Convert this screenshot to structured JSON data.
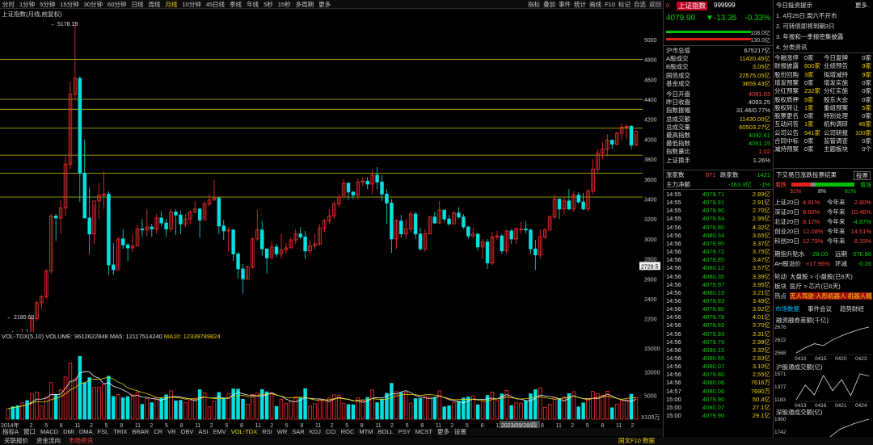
{
  "toolbar": {
    "periods": [
      "分时",
      "1分钟",
      "5分钟",
      "15分钟",
      "30分钟",
      "60分钟",
      "日线",
      "周线",
      "月线",
      "10分钟",
      "45日线",
      "季线",
      "年线",
      "5秒",
      "15秒",
      "多周期",
      "更多"
    ],
    "selected_period": "月线",
    "tools": [
      "指标",
      "叠加",
      "事件",
      "统计",
      "画线",
      "F10",
      "标记",
      "自选",
      "返回"
    ]
  },
  "chart_title": "上证指数(月线,前复权)",
  "price_axis": {
    "labels": [
      "5000",
      "4800",
      "4600",
      "4400",
      "4200",
      "4000",
      "3800",
      "3600",
      "3400",
      "3200",
      "3000",
      "2800",
      "2600",
      "2400",
      "2200"
    ],
    "current": "2729.5",
    "high_label": "5178.19",
    "low_label": "2180.60",
    "left_ticks": [
      "4500",
      "3000",
      "2500"
    ]
  },
  "volume_legend": {
    "name": "VOL-TDX(5,10)",
    "volume": "VOLUME: 9612622848",
    "ma5": "MA5: 12117514240",
    "ma10": "MA10: 12339789824"
  },
  "volume_axis": {
    "labels": [
      "15000",
      "10000",
      "5000"
    ],
    "unit": "X100万"
  },
  "xaxis": {
    "labels": [
      "2014年",
      "2",
      "5",
      "8",
      "11",
      "2",
      "5",
      "8",
      "11",
      "2",
      "5",
      "8",
      "11",
      "2",
      "5",
      "8",
      "11",
      "2",
      "5",
      "8",
      "11",
      "2",
      "5",
      "8",
      "11",
      "2",
      "5",
      "8",
      "11",
      "2",
      "5",
      "8",
      "11",
      "2",
      "5",
      "8",
      "11",
      "2",
      "5",
      "8",
      "11",
      "2"
    ],
    "cursor_date": "2023/09/28/四"
  },
  "indicator_tabs": [
    "指标A",
    "窗口",
    "MACD",
    "DMI",
    "DMA",
    "FSL",
    "TRIX",
    "BRAR",
    "CR",
    "VR",
    "OBV",
    "ASI",
    "EMV",
    "VOL-TDX",
    "RSI",
    "WR",
    "SAR",
    "KDJ",
    "CCI",
    "ROC",
    "MTM",
    "BOLL",
    "PSY",
    "MCST",
    "更多",
    "设置"
  ],
  "selected_indicator": "VOL-TDX",
  "bottom_bar": [
    "关联报价",
    "资金流向",
    "市场资讯"
  ],
  "bottom_right": "国文F10 数据",
  "side": {
    "header": {
      "flag": "0",
      "name": "上证指数",
      "code": "999999"
    },
    "price": "4079.90",
    "change": "▼-13.35",
    "pct": "-0.33%",
    "bars": {
      "up": "108.0亿",
      "down": "130.0亿"
    },
    "stats": [
      {
        "label": "沪市总值",
        "value": "675217亿",
        "color": "white"
      },
      {
        "label": "A股成交",
        "value": "11420.45亿",
        "color": "yellow"
      },
      {
        "label": "B股成交",
        "value": "3.05亿",
        "color": "yellow"
      },
      {
        "label": "国债成交",
        "value": "22575.05亿",
        "color": "yellow"
      },
      {
        "label": "基金成交",
        "value": "3659.43亿",
        "color": "yellow"
      },
      {
        "label": "今日开盘",
        "value": "4081.03",
        "color": "red"
      },
      {
        "label": "昨日收盘",
        "value": "4093.25",
        "color": "white"
      },
      {
        "label": "指数振幅",
        "value": "31.46/0.77%",
        "color": "white"
      },
      {
        "label": "总成交额",
        "value": "11430.00亿",
        "color": "yellow"
      },
      {
        "label": "总成交量",
        "value": "60503.27亿",
        "color": "yellow"
      },
      {
        "label": "最高指数",
        "value": "4092.61",
        "color": "green"
      },
      {
        "label": "最低指数",
        "value": "4061.15",
        "color": "green"
      },
      {
        "label": "指数量比",
        "value": "1.02",
        "color": "red"
      },
      {
        "label": "上证换手",
        "value": "1.26%",
        "color": "white"
      }
    ],
    "updown": {
      "up_label": "涨家数",
      "up": "871",
      "down_label": "跌家数",
      "down": "1421"
    },
    "netflow": {
      "label": "主力净额",
      "value": "-163.3亿",
      "pct": "-1%"
    },
    "ticks": [
      {
        "t": "14:55",
        "p": "4079.71",
        "v": "2.89亿"
      },
      {
        "t": "14:55",
        "p": "4079.91",
        "v": "2.91亿"
      },
      {
        "t": "14:55",
        "p": "4079.90",
        "v": "2.70亿"
      },
      {
        "t": "14:55",
        "p": "4079.84",
        "v": "2.95亿"
      },
      {
        "t": "14:56",
        "p": "4079.80",
        "v": "4.32亿"
      },
      {
        "t": "14:56",
        "p": "4080.34",
        "v": "3.65亿"
      },
      {
        "t": "14:56",
        "p": "4079.95",
        "v": "3.37亿"
      },
      {
        "t": "14:56",
        "p": "4079.72",
        "v": "3.75亿"
      },
      {
        "t": "14:56",
        "p": "4079.85",
        "v": "3.47亿"
      },
      {
        "t": "14:56",
        "p": "4080.12",
        "v": "3.57亿"
      },
      {
        "t": "14:56",
        "p": "4080.35",
        "v": "3.39亿"
      },
      {
        "t": "14:56",
        "p": "4079.97",
        "v": "3.95亿"
      },
      {
        "t": "14:56",
        "p": "4080.19",
        "v": "3.21亿"
      },
      {
        "t": "14:56",
        "p": "4079.93",
        "v": "3.49亿"
      },
      {
        "t": "14:56",
        "p": "4079.80",
        "v": "3.92亿"
      },
      {
        "t": "14:56",
        "p": "4079.78",
        "v": "4.01亿"
      },
      {
        "t": "14:56",
        "p": "4079.93",
        "v": "3.70亿"
      },
      {
        "t": "14:56",
        "p": "4079.93",
        "v": "3.31亿"
      },
      {
        "t": "14:56",
        "p": "4079.79",
        "v": "2.99亿"
      },
      {
        "t": "14:56",
        "p": "4080.15",
        "v": "3.32亿"
      },
      {
        "t": "14:56",
        "p": "4080.55",
        "v": "2.83亿"
      },
      {
        "t": "14:56",
        "p": "4080.07",
        "v": "3.10亿"
      },
      {
        "t": "14:56",
        "p": "4079.80",
        "v": "2.55亿"
      },
      {
        "t": "14:56",
        "p": "4080.06",
        "v": "7616万"
      },
      {
        "t": "14:57",
        "p": "4080.06",
        "v": "7690万"
      },
      {
        "t": "15:00",
        "p": "4079.90",
        "v": "50.4亿"
      },
      {
        "t": "15:00",
        "p": "4080.07",
        "v": "27.1亿"
      },
      {
        "t": "15:00",
        "p": "4079.90",
        "v": "29.1亿"
      }
    ]
  },
  "right": {
    "title": "今日投资提示",
    "more": "更多..",
    "tips": [
      "1. 4月25日:周六不开市",
      "2. 可转债即将到期3只",
      "3. 年报和一季报密集披露",
      "4. 分类资讯"
    ],
    "grid": [
      [
        "今融涨停",
        "0家",
        "今日复牌",
        "0家"
      ],
      [
        "财报披露",
        "600家",
        "业绩预告",
        "9家"
      ],
      [
        "股份回购",
        "3家",
        "拟增减持",
        "9家"
      ],
      [
        "增发预案",
        "0家",
        "增发实施",
        "0家"
      ],
      [
        "分红预案",
        "232家",
        "分红实施",
        "0家"
      ],
      [
        "股权质押",
        "9家",
        "股东大会",
        "0家"
      ],
      [
        "股权转让",
        "1家",
        "重组预案",
        "5家"
      ],
      [
        "股票更名",
        "0家",
        "特别处理",
        "0家"
      ],
      [
        "互动问答",
        "1家",
        "机构调研",
        "46家"
      ],
      [
        "公司公告",
        "541家",
        "公司研报",
        "100家"
      ],
      [
        "合同中标",
        "0家",
        "监管调查",
        "0家"
      ],
      [
        "减持预案",
        "0家",
        "主题板块",
        "0个"
      ]
    ],
    "result_title": "下交易日涨跌投票结果",
    "vote_button": "投票",
    "vote": {
      "bear": "看跌",
      "bull": "看涨",
      "bear_pct": "31%",
      "mid_pct": "8%",
      "bull_pct": "61%"
    },
    "perf": [
      [
        "上证20日",
        "4.91%",
        "今年来",
        "2.80%"
      ],
      [
        "深证20日",
        "9.80%",
        "今年来",
        "10.46%"
      ],
      [
        "北证20日",
        "8.17%",
        "今年来",
        "-4.87%"
      ],
      [
        "创业20日",
        "12.08%",
        "今年来",
        "14.51%"
      ],
      [
        "科创20日",
        "12.79%",
        "今年来",
        "8.15%"
      ]
    ],
    "futures": {
      "label": "期指升贴水",
      "near": "-28.00",
      "far_label": "远期",
      "far": "-376.86"
    },
    "ah": {
      "label": "AH股溢价",
      "value": "+17.96%",
      "chg_label": "环减",
      "chg": "-0.26"
    },
    "rotation": [
      {
        "label": "轮动",
        "text": "大盘股 > 小盘股(已6天)",
        "color": "white"
      },
      {
        "label": "板块",
        "text": "医疗 > 芯片(已6天)",
        "color": "white"
      },
      {
        "label": "热点",
        "text": "无人驾驶 人形机器人 机器人概",
        "color": "yellow"
      }
    ],
    "tabs": [
      "市场数据",
      "事件会议",
      "趋势财经"
    ],
    "mini": [
      {
        "title": "融资融券差额(千亿)",
        "y": [
          "2676",
          "2622",
          "2568"
        ],
        "x": [
          "0410",
          "0415",
          "0420",
          "0423"
        ],
        "values": [
          2570,
          2590,
          2605,
          2598,
          2620,
          2635,
          2648,
          2660,
          2668
        ]
      },
      {
        "title": "沪股通成交额(亿)",
        "y": [
          "1571",
          "1377",
          "1183"
        ],
        "x": [
          "0413",
          "0416",
          "0421",
          "0424"
        ],
        "values": [
          1190,
          1400,
          1260,
          1540,
          1320,
          1480,
          1250,
          1560,
          1530
        ]
      },
      {
        "title": "深股通成交额(亿)",
        "y": [
          "1960",
          "1742"
        ],
        "x": [],
        "values": [
          1750,
          1800,
          1780,
          1860,
          1900,
          1930
        ]
      }
    ]
  },
  "chart_data": {
    "type": "candlestick",
    "title": "上证指数(月线,前复权)",
    "ylim": [
      2100,
      5250
    ],
    "hlines": [
      4800,
      4400,
      4300,
      4110,
      3840,
      3660,
      3420
    ],
    "candles": [
      [
        2040,
        2070,
        1990,
        2050
      ],
      [
        2050,
        2080,
        2000,
        2040
      ],
      [
        2040,
        2070,
        2010,
        2030
      ],
      [
        2030,
        2100,
        2020,
        2050
      ],
      [
        2050,
        2100,
        2010,
        2040
      ],
      [
        2040,
        2230,
        2030,
        2200
      ],
      [
        2200,
        2380,
        2180,
        2360
      ],
      [
        2360,
        2440,
        2300,
        2420
      ],
      [
        2420,
        2700,
        2400,
        2680
      ],
      [
        2680,
        3250,
        2650,
        3230
      ],
      [
        3230,
        3250,
        2980,
        3210
      ],
      [
        3210,
        3390,
        3050,
        3310
      ],
      [
        3310,
        3830,
        3230,
        3750
      ],
      [
        3750,
        4580,
        3700,
        4450
      ],
      [
        4450,
        5178,
        4400,
        4610
      ],
      [
        4610,
        4630,
        3370,
        3660
      ],
      [
        3660,
        4000,
        3400,
        3210
      ],
      [
        3210,
        3520,
        2850,
        3050
      ],
      [
        3050,
        3350,
        2950,
        3380
      ],
      [
        3380,
        3560,
        3200,
        3440
      ],
      [
        3440,
        3680,
        3300,
        3450
      ],
      [
        3450,
        3480,
        2640,
        2740
      ],
      [
        2740,
        2960,
        2640,
        2690
      ],
      [
        2690,
        3020,
        2700,
        3000
      ],
      [
        3000,
        3100,
        2900,
        2940
      ],
      [
        2940,
        2960,
        2780,
        2910
      ],
      [
        2910,
        3050,
        2870,
        2930
      ],
      [
        2930,
        3140,
        2940,
        3100
      ],
      [
        3100,
        3200,
        3020,
        3090
      ],
      [
        3090,
        3300,
        3030,
        3120
      ],
      [
        3120,
        3150,
        3020,
        3100
      ],
      [
        3100,
        3250,
        3050,
        3210
      ],
      [
        3210,
        3280,
        3130,
        3160
      ],
      [
        3160,
        3200,
        3020,
        3100
      ],
      [
        3100,
        3300,
        3070,
        3270
      ],
      [
        3270,
        3300,
        3040,
        3240
      ],
      [
        3240,
        3280,
        3050,
        3150
      ],
      [
        3150,
        3250,
        3120,
        3200
      ],
      [
        3200,
        3290,
        3150,
        3270
      ],
      [
        3270,
        3380,
        3260,
        3300
      ],
      [
        3300,
        3310,
        3010,
        3190
      ],
      [
        3190,
        3380,
        3200,
        3350
      ],
      [
        3350,
        3450,
        3330,
        3390
      ],
      [
        3390,
        3590,
        3380,
        3410
      ],
      [
        3410,
        3420,
        3050,
        3130
      ],
      [
        3130,
        3190,
        2990,
        3080
      ],
      [
        3080,
        3120,
        2870,
        3090
      ],
      [
        3090,
        3100,
        2780,
        2850
      ],
      [
        2850,
        2870,
        2600,
        2700
      ],
      [
        2700,
        2750,
        2450,
        2600
      ],
      [
        2600,
        2730,
        2590,
        2720
      ],
      [
        2720,
        3020,
        2700,
        3000
      ],
      [
        3000,
        3290,
        2980,
        3090
      ],
      [
        3090,
        3180,
        2830,
        2900
      ],
      [
        2900,
        2900,
        2650,
        2810
      ],
      [
        2810,
        2980,
        2820,
        2920
      ],
      [
        2920,
        2950,
        2820,
        2850
      ],
      [
        2850,
        3050,
        2800,
        2890
      ],
      [
        2890,
        2960,
        2850,
        2910
      ],
      [
        2910,
        3020,
        2910,
        2990
      ],
      [
        2990,
        3100,
        2950,
        3050
      ],
      [
        3050,
        3120,
        3000,
        3020
      ],
      [
        3020,
        3080,
        2800,
        2880
      ],
      [
        2880,
        2990,
        2850,
        2930
      ],
      [
        2930,
        3050,
        2900,
        2950
      ],
      [
        2950,
        3150,
        2930,
        3110
      ],
      [
        3110,
        3200,
        3070,
        3180
      ],
      [
        3180,
        3300,
        3150,
        3230
      ],
      [
        3230,
        3380,
        3200,
        3350
      ],
      [
        3350,
        3450,
        3320,
        3420
      ],
      [
        3420,
        3600,
        3400,
        3560
      ],
      [
        3560,
        3520,
        3390,
        3470
      ],
      [
        3470,
        3480,
        3400,
        3440
      ],
      [
        3440,
        3600,
        3400,
        3570
      ],
      [
        3570,
        3620,
        3530,
        3580
      ],
      [
        3580,
        3620,
        3500,
        3550
      ],
      [
        3550,
        3700,
        3450,
        3640
      ],
      [
        3640,
        3720,
        3500,
        3570
      ],
      [
        3570,
        3640,
        3380,
        3450
      ],
      [
        3450,
        3500,
        3150,
        3360
      ],
      [
        3360,
        3400,
        2860,
        3000
      ],
      [
        3000,
        3200,
        2900,
        3180
      ],
      [
        3180,
        3240,
        3010,
        3050
      ],
      [
        3050,
        3200,
        3000,
        3100
      ],
      [
        3100,
        3280,
        3070,
        3250
      ],
      [
        3250,
        3270,
        3000,
        3050
      ],
      [
        3050,
        3110,
        2880,
        2900
      ],
      [
        2900,
        3100,
        2870,
        3050
      ],
      [
        3050,
        3230,
        3050,
        3220
      ],
      [
        3220,
        3270,
        3150,
        3160
      ],
      [
        3160,
        3380,
        3150,
        3290
      ],
      [
        3290,
        3290,
        3170,
        3200
      ],
      [
        3200,
        3240,
        3140,
        3150
      ],
      [
        3150,
        3280,
        3150,
        3260
      ],
      [
        3260,
        3320,
        3200,
        3220
      ],
      [
        3220,
        3250,
        3100,
        3120
      ],
      [
        3120,
        3130,
        3000,
        3030
      ],
      [
        3030,
        3110,
        3000,
        3050
      ],
      [
        3050,
        3050,
        2880,
        2920
      ],
      [
        2920,
        3000,
        2800,
        2970
      ],
      [
        2970,
        3000,
        2700,
        2760
      ],
      [
        2760,
        3070,
        2740,
        3020
      ],
      [
        3020,
        3080,
        2990,
        3030
      ],
      [
        3030,
        3050,
        2850,
        2880
      ],
      [
        2880,
        3090,
        2850,
        3080
      ],
      [
        3080,
        3100,
        2950,
        3000
      ],
      [
        3000,
        3120,
        2950,
        3100
      ],
      [
        3100,
        3170,
        3050,
        3100
      ],
      [
        3100,
        3180,
        3050,
        3090
      ],
      [
        3090,
        3100,
        2850,
        2900
      ],
      [
        2900,
        2990,
        2690,
        2840
      ],
      [
        2840,
        3100,
        2800,
        3020
      ],
      [
        3020,
        3110,
        3000,
        3090
      ],
      [
        3090,
        3240,
        3100,
        3220
      ],
      [
        3220,
        3450,
        3200,
        3400
      ],
      [
        3400,
        3380,
        3200,
        3300
      ],
      [
        3300,
        3420,
        3250,
        3380
      ],
      [
        3380,
        3500,
        3290,
        3300
      ],
      [
        3300,
        3480,
        3270,
        3440
      ],
      [
        3440,
        3470,
        3350,
        3370
      ],
      [
        3370,
        3460,
        3290,
        3300
      ],
      [
        3300,
        3500,
        3280,
        3480
      ],
      [
        3480,
        3800,
        3450,
        3700
      ],
      [
        3700,
        3900,
        3650,
        3860
      ],
      [
        3860,
        3970,
        3800,
        3900
      ],
      [
        3900,
        4050,
        3830,
        3990
      ],
      [
        3990,
        4000,
        3900,
        3950
      ],
      [
        3950,
        4080,
        3940,
        4060
      ],
      [
        4060,
        4160,
        3980,
        4120
      ],
      [
        4120,
        4150,
        4000,
        4130
      ],
      [
        4130,
        4140,
        3900,
        3940
      ],
      [
        3940,
        4050,
        3930,
        4080
      ]
    ],
    "volume_ma5_ma10": "VOL-TDX(5,10)"
  }
}
